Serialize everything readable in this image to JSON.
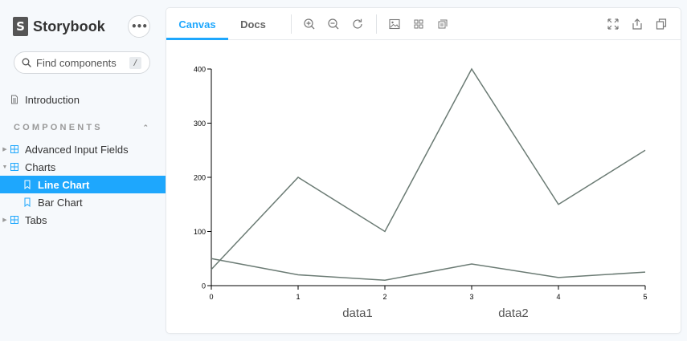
{
  "brand": {
    "logo_letter": "S",
    "name": "Storybook"
  },
  "sidebar": {
    "menu_icon": "ellipsis-icon",
    "search": {
      "placeholder": "Find components",
      "shortcut": "/"
    },
    "introduction": "Introduction",
    "section_title": "COMPONENTS",
    "items": [
      {
        "label": "Advanced Input Fields",
        "icon": "component-icon",
        "expanded": false
      },
      {
        "label": "Charts",
        "icon": "component-icon",
        "expanded": true
      },
      {
        "label": "Line Chart",
        "icon": "bookmark-icon",
        "active": true
      },
      {
        "label": "Bar Chart",
        "icon": "bookmark-icon",
        "active": false
      },
      {
        "label": "Tabs",
        "icon": "component-icon",
        "expanded": false
      }
    ],
    "active_color": "#1ea7fd"
  },
  "toolbar": {
    "tabs": [
      {
        "label": "Canvas",
        "active": true
      },
      {
        "label": "Docs",
        "active": false
      }
    ],
    "tools": [
      "zoom-in-icon",
      "zoom-out-icon",
      "zoom-reset-icon",
      "background-icon",
      "grid-icon",
      "outline-icon"
    ],
    "right_tools": [
      "fullscreen-icon",
      "share-icon",
      "copy-icon"
    ]
  },
  "chart_data": {
    "type": "line",
    "x": [
      0,
      1,
      2,
      3,
      4,
      5
    ],
    "series": [
      {
        "name": "data1",
        "values": [
          30,
          200,
          100,
          400,
          150,
          250
        ]
      },
      {
        "name": "data2",
        "values": [
          50,
          20,
          10,
          40,
          15,
          25
        ]
      }
    ],
    "xticks": [
      "0",
      "1",
      "2",
      "3",
      "4",
      "5"
    ],
    "yticks": [
      "0",
      "100",
      "200",
      "300",
      "400"
    ],
    "ylim": [
      0,
      400
    ],
    "xlim": [
      0,
      5
    ],
    "grid": false,
    "legend_position": "bottom",
    "line_color": "#6b7b74"
  }
}
